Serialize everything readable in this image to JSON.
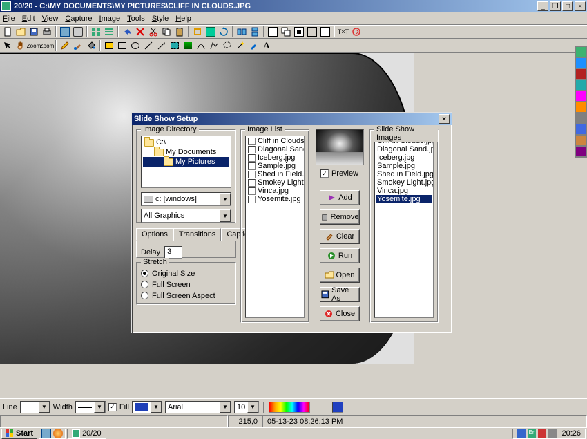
{
  "app": {
    "title": "20/20 - C:\\MY DOCUMENTS\\MY PICTURES\\CLIFF IN CLOUDS.JPG",
    "menus": [
      "File",
      "Edit",
      "View",
      "Capture",
      "Image",
      "Tools",
      "Style",
      "Help"
    ]
  },
  "palette_colors": [
    "#3cb371",
    "#1e90ff",
    "#b22222",
    "#2aa",
    "#ff00ff",
    "#ff8c00",
    "#808080",
    "#4169e1",
    "#cd853f",
    "#800080"
  ],
  "dialog": {
    "title": "Slide Show Setup",
    "groups": {
      "image_directory": "Image Directory",
      "image_list": "Image List",
      "slideshow_images": "Slide Show Images",
      "stretch": "Stretch"
    },
    "tree": [
      {
        "label": "C:\\",
        "indent": 0
      },
      {
        "label": "My Documents",
        "indent": 1
      },
      {
        "label": "My Pictures",
        "indent": 2,
        "selected": true
      }
    ],
    "drive_combo": "c: [windows]",
    "filter_combo": "All Graphics",
    "tabs": [
      "Options",
      "Transitions",
      "Caption"
    ],
    "active_tab": 0,
    "delay_label": "Delay",
    "delay_value": "3",
    "stretch_options": [
      "Original Size",
      "Full Screen",
      "Full Screen Aspect"
    ],
    "stretch_selected": 0,
    "image_list": [
      "Cliff in Clouds.jpg",
      "Diagonal Sand.jpg",
      "Iceberg.jpg",
      "Sample.jpg",
      "Shed in Field.jpg",
      "Smokey Light.jpg",
      "Vinca.jpg",
      "Yosemite.jpg"
    ],
    "slideshow_list": [
      "Cliff in Clouds.jpg",
      "Diagonal Sand.jpg",
      "Iceberg.jpg",
      "Sample.jpg",
      "Shed in Field.jpg",
      "Smokey Light.jpg",
      "Vinca.jpg",
      "Yosemite.jpg"
    ],
    "slideshow_selected": 7,
    "preview_label": "Preview",
    "preview_checked": true,
    "buttons": {
      "add": "Add",
      "remove": "Remove",
      "clear": "Clear",
      "run": "Run",
      "open": "Open",
      "saveas": "Save As",
      "close": "Close"
    }
  },
  "bottom": {
    "line_label": "Line",
    "width_label": "Width",
    "fill_label": "Fill",
    "font": "Arial",
    "font_size": "10",
    "coord": "215,0",
    "timestamp": "05-13-23 08:26:13 PM",
    "fill_color": "#1e3fb8",
    "swatch": "#2040c0"
  },
  "taskbar": {
    "start": "Start",
    "task": "20/20",
    "clock": "20:26"
  }
}
